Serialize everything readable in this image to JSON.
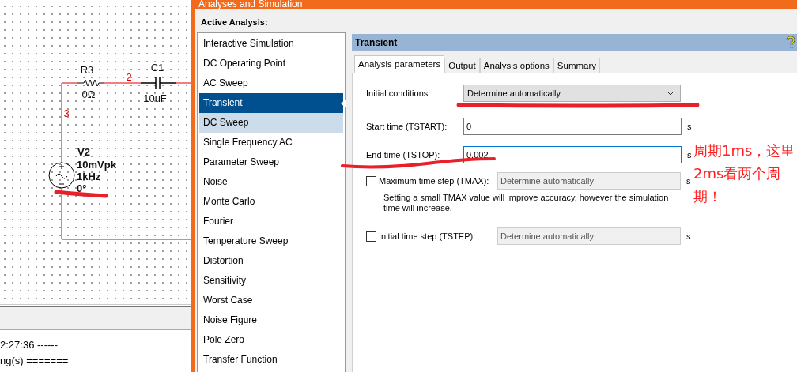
{
  "schematic": {
    "components": [
      {
        "kind": "resistor",
        "ref": "R3",
        "value": "0Ω"
      },
      {
        "kind": "capacitor",
        "ref": "C1",
        "value": "10uF"
      },
      {
        "kind": "source",
        "ref": "V2",
        "lines": [
          "10mVpk",
          "1kHz",
          "0°"
        ]
      }
    ],
    "nodes": [
      "2",
      "3"
    ]
  },
  "log": {
    "lines": [
      "2:27:36 ------",
      "ng(s) ======="
    ]
  },
  "dialog": {
    "title": "Analyses and Simulation",
    "list_label": "Active Analysis:",
    "analyses": [
      {
        "label": "Interactive Simulation",
        "selected": false,
        "hover": false
      },
      {
        "label": "DC Operating Point",
        "selected": false,
        "hover": false
      },
      {
        "label": "AC Sweep",
        "selected": false,
        "hover": false
      },
      {
        "label": "Transient",
        "selected": true,
        "hover": false
      },
      {
        "label": "DC Sweep",
        "selected": false,
        "hover": true
      },
      {
        "label": "Single Frequency AC",
        "selected": false,
        "hover": false
      },
      {
        "label": "Parameter Sweep",
        "selected": false,
        "hover": false
      },
      {
        "label": "Noise",
        "selected": false,
        "hover": false
      },
      {
        "label": "Monte Carlo",
        "selected": false,
        "hover": false
      },
      {
        "label": "Fourier",
        "selected": false,
        "hover": false
      },
      {
        "label": "Temperature Sweep",
        "selected": false,
        "hover": false
      },
      {
        "label": "Distortion",
        "selected": false,
        "hover": false
      },
      {
        "label": "Sensitivity",
        "selected": false,
        "hover": false
      },
      {
        "label": "Worst Case",
        "selected": false,
        "hover": false
      },
      {
        "label": "Noise Figure",
        "selected": false,
        "hover": false
      },
      {
        "label": "Pole Zero",
        "selected": false,
        "hover": false
      },
      {
        "label": "Transfer Function",
        "selected": false,
        "hover": false
      }
    ],
    "panel_title": "Transient",
    "tabs": [
      {
        "label": "Analysis parameters",
        "selected": true
      },
      {
        "label": "Output",
        "selected": false
      },
      {
        "label": "Analysis options",
        "selected": false
      },
      {
        "label": "Summary",
        "selected": false
      }
    ],
    "fields": [
      {
        "kind": "dropdown",
        "label": "Initial conditions:",
        "value": "Determine automatically"
      },
      {
        "kind": "text",
        "label": "Start time (TSTART):",
        "value": "0",
        "unit": "s",
        "focused": false
      },
      {
        "kind": "text",
        "label": "End time (TSTOP):",
        "value": "0.002",
        "unit": "s",
        "focused": true
      },
      {
        "kind": "check",
        "label": "Maximum time step (TMAX):",
        "value": "Determine automatically",
        "unit": "s",
        "checked": false,
        "hint": "Setting a small TMAX value will improve accuracy, however the simulation time will increase."
      },
      {
        "kind": "check",
        "label": "Initial time step (TSTEP):",
        "value": "Determine automatically",
        "unit": "s",
        "checked": false
      }
    ]
  },
  "annotation": {
    "text": "周期1ms，这里2ms看两个周期！"
  }
}
